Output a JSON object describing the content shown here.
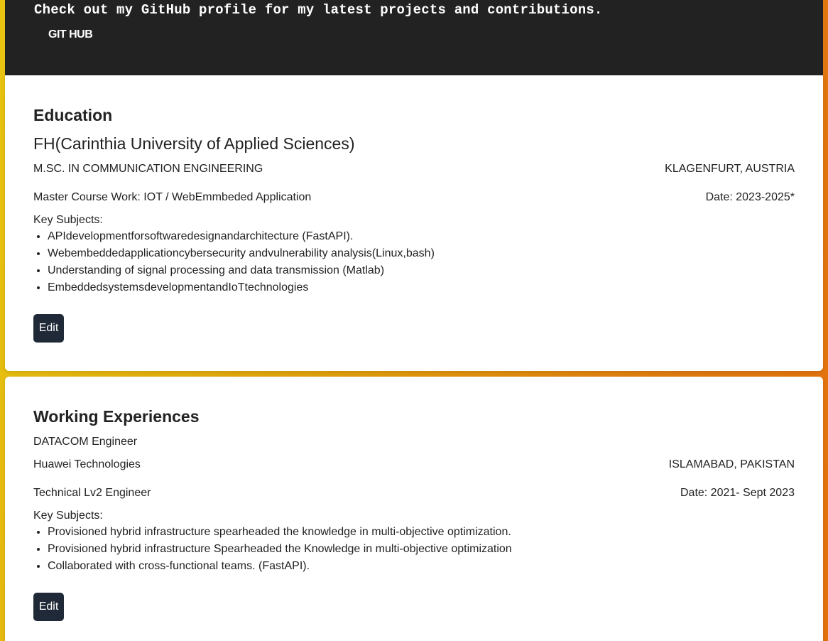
{
  "header": {
    "tagline": "Check out my GitHub profile for my latest projects and contributions.",
    "github_label": "GIT HUB"
  },
  "education": {
    "title": "Education",
    "institution": "FH(Carinthia University of Applied Sciences)",
    "degree": "M.SC. IN COMMUNICATION ENGINEERING",
    "location": "KLAGENFURT, AUSTRIA",
    "coursework": "Master Course Work: IOT / WebEmmbeded Application",
    "date": "Date: 2023-2025*",
    "key_subjects_label": "Key Subjects:",
    "subjects": [
      "APIdevelopmentforsoftwaredesignandarchitecture (FastAPI).",
      "Webembeddedapplicationcybersecurity andvulnerability analysis(Linux,bash)",
      "Understanding of signal processing and data transmission (Matlab)",
      "EmbeddedsystemsdevelopmentandIoTtechnologies"
    ],
    "edit_label": "Edit"
  },
  "work": {
    "title": "Working Experiences",
    "role": "DATACOM Engineer",
    "company": "Huawei Technologies",
    "location": "ISLAMABAD, PAKISTAN",
    "position": "Technical Lv2 Engineer",
    "date": "Date: 2021- Sept 2023",
    "key_subjects_label": "Key Subjects:",
    "subjects": [
      "Provisioned hybrid infrastructure spearheaded the knowledge in multi-objective optimization.",
      "Provisioned hybrid infrastructure Spearheaded the Knowledge in multi-objective optimization",
      "Collaborated with cross-functional teams. (FastAPI)."
    ],
    "edit_label": "Edit"
  }
}
